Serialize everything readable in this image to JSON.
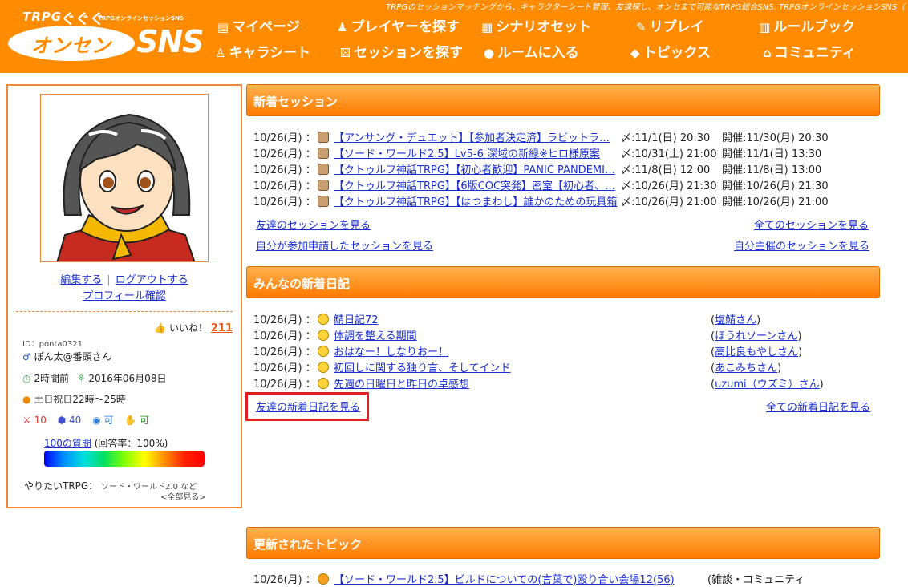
{
  "header": {
    "tagline": "TRPGのセッションマッチングから、キャラクターシート管理、友達探し、オンセまで可能なTRPG総合SNS: TRPGオンラインセッションSNS（",
    "logo": {
      "trpg": "TRPG",
      "waves": "ぐぐぐ",
      "sub": "TRPGオンラインセッションSNS",
      "main": "オンセン",
      "sns": "SNS"
    },
    "nav": [
      {
        "label": "マイページ",
        "icon": "mypage-icon"
      },
      {
        "label": "プレイヤーを探す",
        "icon": "player-icon"
      },
      {
        "label": "シナリオセット",
        "icon": "scenario-icon"
      },
      {
        "label": "リプレイ",
        "icon": "replay-icon"
      },
      {
        "label": "ルールブック",
        "icon": "rulebook-icon"
      },
      {
        "label": "キャラシート",
        "icon": "person-icon"
      },
      {
        "label": "セッションを探す",
        "icon": "dice-icon"
      },
      {
        "label": "ルームに入る",
        "icon": "chat-icon"
      },
      {
        "label": "トピックス",
        "icon": "tag-icon"
      },
      {
        "label": "コミュニティ",
        "icon": "building-icon"
      }
    ]
  },
  "profile": {
    "edit": "編集する",
    "logout": "ログアウトする",
    "check": "プロフィール確認",
    "like_label": "いいね！",
    "like_count": "211",
    "id": "ID：ponta0321",
    "name": "ぽん太@番頭さん",
    "last_login": "2時間前",
    "joined": "2016年06月08日",
    "time": "土日祝日22時～25時",
    "stat1": "10",
    "stat2": "40",
    "stat3": "可",
    "stat4": "可",
    "questions_link": "100の質問",
    "questions_rate": "(回答率：100%)",
    "want_label": "やりたいTRPG：",
    "want_value": "ソード・ワールド2.0 など",
    "see_all": "<全部見る>"
  },
  "sessions": {
    "heading": "新着セッション",
    "items": [
      {
        "date": "10/26(月) ：",
        "title": "【アンサング・デュエット】【参加者決定済】ラビットラ…",
        "deadline": "〆:11/1(日) 20:30",
        "held": "開催:11/30(月) 20:30"
      },
      {
        "date": "10/26(月) ：",
        "title": "【ソード・ワールド2.5】Lv5-6 深域の新緑※ヒロ様原案",
        "deadline": "〆:10/31(土) 21:00",
        "held": "開催:11/1(日) 13:30"
      },
      {
        "date": "10/26(月) ：",
        "title": "【クトゥルフ神話TRPG】【初心者歓迎】PANIC PANDEMI…",
        "deadline": "〆:11/8(日) 12:00",
        "held": "開催:11/8(日) 13:00"
      },
      {
        "date": "10/26(月) ：",
        "title": "【クトゥルフ神話TRPG】【6版COC突発】密室【初心者、…",
        "deadline": "〆:10/26(月) 21:30",
        "held": "開催:10/26(月) 21:30"
      },
      {
        "date": "10/26(月) ：",
        "title": "【クトゥルフ神話TRPG】【はつまわし】誰かのための玩具箱",
        "deadline": "〆:10/26(月) 21:00",
        "held": "開催:10/26(月) 21:00"
      }
    ],
    "friends_link": "友達のセッションを見る",
    "all_link": "全てのセッションを見る",
    "applied_link": "自分が参加申請したセッションを見る",
    "hosted_link": "自分主催のセッションを見る"
  },
  "diaries": {
    "heading": "みんなの新着日記",
    "items": [
      {
        "date": "10/26(月) ：",
        "title": "鯖日記72",
        "author": "塩鯖さん"
      },
      {
        "date": "10/26(月) ：",
        "title": "体調を整える期間",
        "author": "ほうれソーンさん"
      },
      {
        "date": "10/26(月) ：",
        "title": "おはなー！しなりおー！",
        "author": "高比良もやしさん"
      },
      {
        "date": "10/26(月) ：",
        "title": "初回しに関する独り言、そしてインド",
        "author": "あこみちさん"
      },
      {
        "date": "10/26(月) ：",
        "title": "先週の日曜日と昨日の卓感想",
        "author": "uzumi（ウズミ）さん"
      }
    ],
    "friends_link": "友達の新着日記を見る",
    "all_link": "全ての新着日記を見る"
  },
  "topics": {
    "heading": "更新されたトピック",
    "items": [
      {
        "date": "10/26(月) ：",
        "title": "【ソード・ワールド2.5】ビルドについての(言葉で)殴り合い会場12(56)",
        "category": "(雑談・コミュニティ"
      }
    ]
  }
}
